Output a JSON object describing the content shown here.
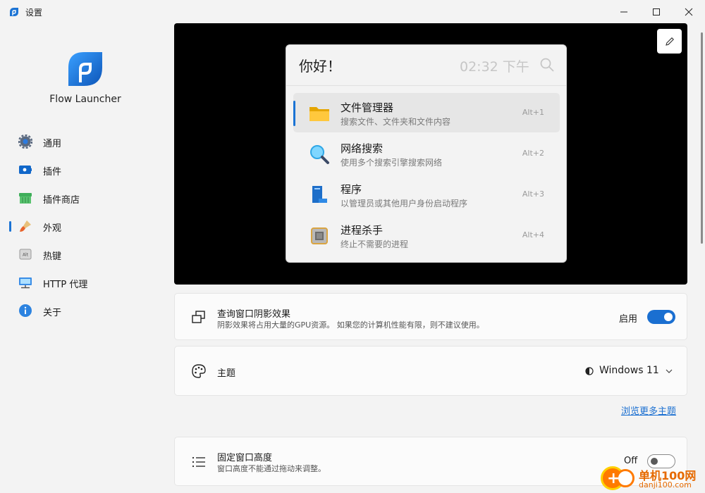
{
  "window": {
    "title": "设置",
    "controls": {
      "minimize": "—",
      "maximize": "☐",
      "close": "✕"
    }
  },
  "sidebar": {
    "brand": "Flow Launcher",
    "items": [
      {
        "label": "通用",
        "icon": "gear-icon"
      },
      {
        "label": "插件",
        "icon": "plugin-icon"
      },
      {
        "label": "插件商店",
        "icon": "store-icon"
      },
      {
        "label": "外观",
        "icon": "paintbrush-icon",
        "selected": true
      },
      {
        "label": "热键",
        "icon": "keyboard-icon"
      },
      {
        "label": "HTTP 代理",
        "icon": "network-icon"
      },
      {
        "label": "关于",
        "icon": "info-icon"
      }
    ]
  },
  "preview": {
    "query": "你好！",
    "clock": "02:32 下午",
    "results": [
      {
        "title": "文件管理器",
        "subtitle": "搜索文件、文件夹和文件内容",
        "hotkey": "Alt+1",
        "icon": "folder-icon"
      },
      {
        "title": "网络搜索",
        "subtitle": "使用多个搜索引擎搜索网络",
        "hotkey": "Alt+2",
        "icon": "magnifier-icon"
      },
      {
        "title": "程序",
        "subtitle": "以管理员或其他用户身份启动程序",
        "hotkey": "Alt+3",
        "icon": "book-icon"
      },
      {
        "title": "进程杀手",
        "subtitle": "终止不需要的进程",
        "hotkey": "Alt+4",
        "icon": "cpu-icon"
      }
    ]
  },
  "settings": {
    "shadow": {
      "title": "查询窗口阴影效果",
      "desc": "阴影效果将占用大量的GPU资源。 如果您的计算机性能有限，则不建议使用。",
      "state_label": "启用",
      "enabled": true
    },
    "theme": {
      "title": "主题",
      "value": "Windows 11"
    },
    "browse_link": "浏览更多主题",
    "fixed_height": {
      "title": "固定窗口高度",
      "desc": "窗口高度不能通过拖动来调整。",
      "state_label": "Off",
      "enabled": false
    }
  },
  "watermark": {
    "line1": "单机100网",
    "line2": "danji100.com"
  },
  "colors": {
    "accent": "#1a6fd1",
    "preview_bg": "#000000",
    "window_bg": "#f3f3f3"
  }
}
